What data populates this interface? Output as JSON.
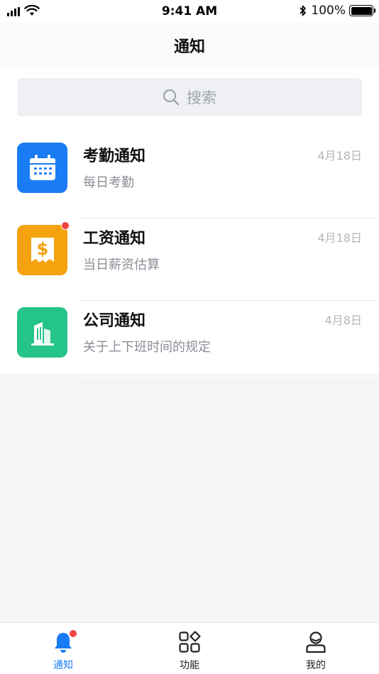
{
  "status_bar": {
    "time": "9:41 AM",
    "battery": "100%",
    "icons": [
      "signal-icon",
      "wifi-icon",
      "bluetooth-icon",
      "battery-icon"
    ]
  },
  "header": {
    "title": "通知"
  },
  "search": {
    "placeholder": "搜索"
  },
  "messages": [
    {
      "title": "考勤通知",
      "subtitle": "每日考勤",
      "date": "4月18日",
      "icon": "calendar-icon",
      "color": "#1a7cf5",
      "unread": false
    },
    {
      "title": "工资通知",
      "subtitle": "当日薪资估算",
      "date": "4月18日",
      "icon": "salary-receipt-icon",
      "color": "#f5a20f",
      "unread": true
    },
    {
      "title": "公司通知",
      "subtitle": "关于上下班时间的规定",
      "date": "4月8日",
      "icon": "building-icon",
      "color": "#25c488",
      "unread": false
    }
  ],
  "tabs": [
    {
      "label": "通知",
      "icon": "bell-icon",
      "active": true,
      "badge": true
    },
    {
      "label": "功能",
      "icon": "grid-icon",
      "active": false
    },
    {
      "label": "我的",
      "icon": "profile-icon",
      "active": false
    }
  ],
  "colors": {
    "accent": "#1a7cf5",
    "badge": "#f24343",
    "background": "#f5f6f8"
  }
}
